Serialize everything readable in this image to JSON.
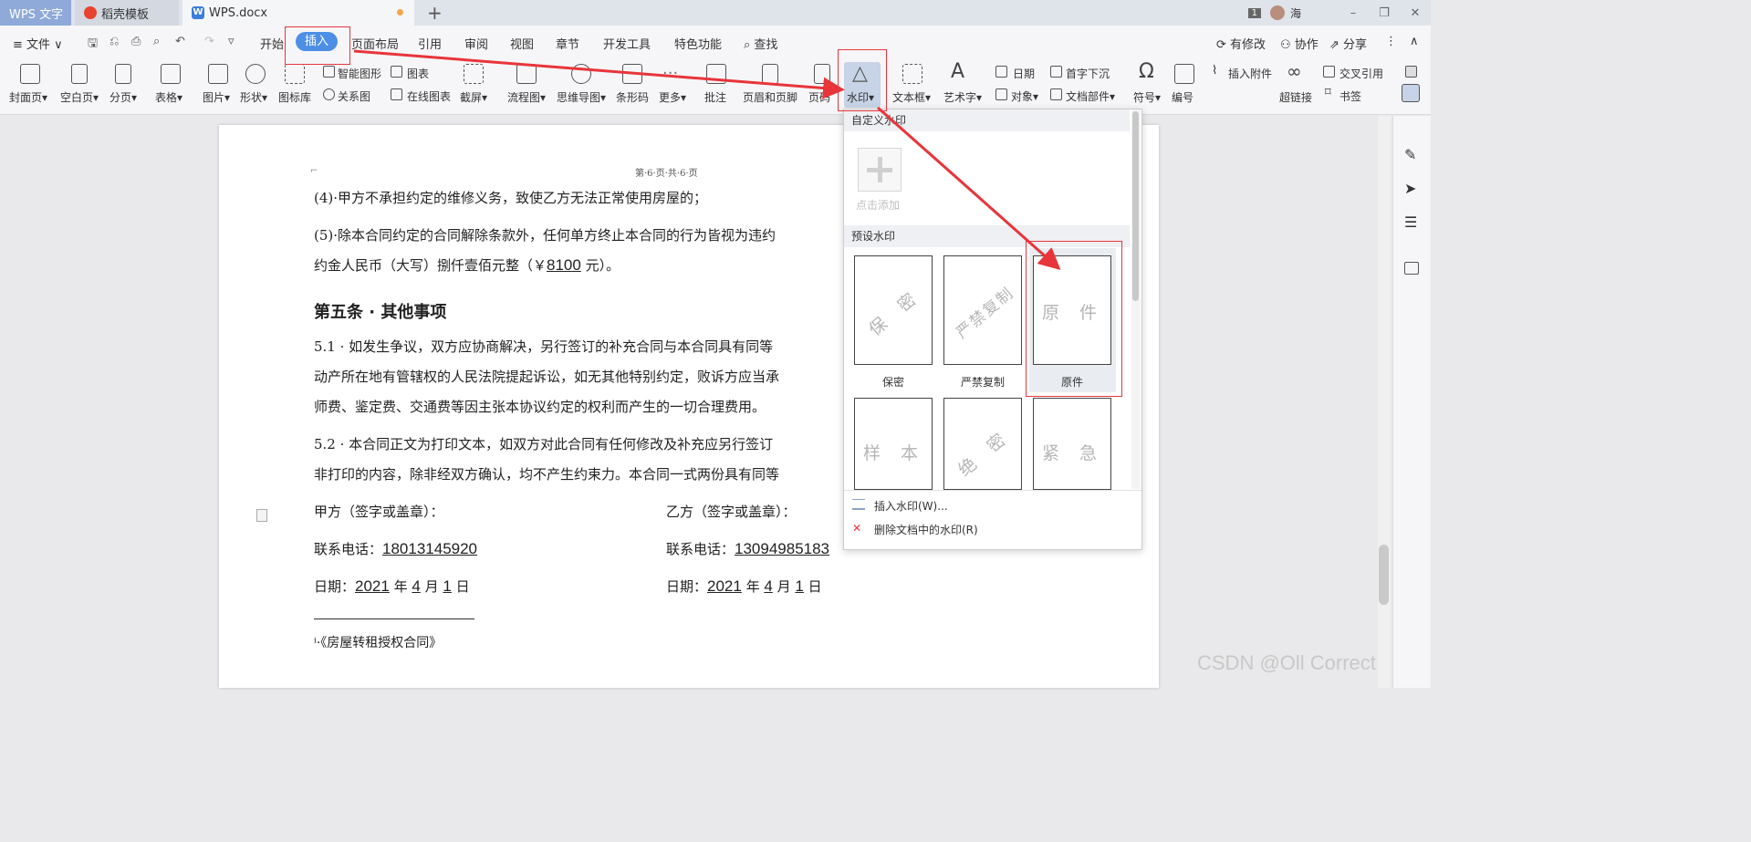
{
  "titlebar": {
    "app_tab": "WPS 文字",
    "docer_tab": "稻壳模板",
    "doc_tab": "WPS.docx",
    "add_tab": "+",
    "badge": "1",
    "user": "海",
    "min": "–",
    "max": "❐",
    "close": "✕"
  },
  "menubar": {
    "file": "≡ 文件 ∨",
    "tabs": [
      "开始",
      "插入",
      "页面布局",
      "引用",
      "审阅",
      "视图",
      "章节",
      "开发工具",
      "特色功能"
    ],
    "search": "查找",
    "right": [
      "有修改",
      "协作",
      "分享"
    ]
  },
  "ribbon": {
    "cover": "封面页",
    "blank": "空白页",
    "pagebreak": "分页",
    "table": "表格",
    "picture": "图片",
    "shape": "形状",
    "iconlib": "图标库",
    "smartart": "智能图形",
    "chart": "图表",
    "relation": "关系图",
    "online_chart": "在线图表",
    "screenshot": "截屏",
    "flowchart": "流程图",
    "mindmap": "思维导图",
    "barcode": "条形码",
    "more": "更多",
    "comment": "批注",
    "header_footer": "页眉和页脚",
    "page_no": "页码",
    "watermark": "水印",
    "textbox": "文本框",
    "wordart": "艺术字",
    "date": "日期",
    "object": "对象",
    "dropcap": "首字下沉",
    "docpart": "文档部件",
    "symbol": "符号",
    "number": "编号",
    "attach": "插入附件",
    "hyperlink": "超链接",
    "crossref": "交叉引用",
    "bookmark": "书签"
  },
  "document": {
    "page_header": "第·6·页·共·6·页",
    "item4": "(4)·甲方不承担约定的维修义务，致使乙方无法正常使用房屋的；",
    "item5_a": "(5)·除本合同约定的合同解除条款外，任何单方终止本合同的行为皆视为违约",
    "item5_b_pre": "约金人民币（大写）捌仟壹佰元整（￥",
    "item5_amount": "8100",
    "item5_b_post": " 元）。",
    "section5_title": "第五条 · 其他事项",
    "s51_a": "5.1 ·  如发生争议，双方应协商解决，另行签订的补充合同与本合同具有同等",
    "s51_b": "动产所在地有管辖权的人民法院提起诉讼，如无其他特别约定，败诉方应当承",
    "s51_c": "师费、鉴定费、交通费等因主张本协议约定的权利而产生的一切合理费用。",
    "s52_a": "5.2 ·  本合同正文为打印文本，如双方对此合同有任何修改及补充应另行签订",
    "s52_b": "非打印的内容，除非经双方确认，均不产生约束力。本合同一式两份具有同等",
    "party_a_sign": "甲方（签字或盖章）：",
    "party_b_sign": "乙方（签字或盖章）：",
    "phone_label": "联系电话：",
    "phone_a": "18013145920",
    "phone_b": "13094985183",
    "date_label": "日期：",
    "date_year": "2021",
    "date_y_unit": " 年 ",
    "date_month": "4",
    "date_m_unit": " 月 ",
    "date_day": "1",
    "date_d_unit": " 日",
    "footnote": "ⁱ·《房屋转租授权合同》"
  },
  "watermark_menu": {
    "custom_section": "自定义水印",
    "add_label": "点击添加",
    "preset_section": "预设水印",
    "presets": [
      {
        "text": "保 密",
        "label": "保密"
      },
      {
        "text": "严禁复制",
        "label": "严禁复制"
      },
      {
        "text": "原 件",
        "label": "原件"
      },
      {
        "text": "样 本",
        "label": ""
      },
      {
        "text": "绝 密",
        "label": ""
      },
      {
        "text": "紧 急",
        "label": ""
      }
    ],
    "insert_action": "插入水印(W)...",
    "delete_action": "删除文档中的水印(R)"
  },
  "watermark_credit": "CSDN @Oll Correct",
  "colors": {
    "accent": "#4e8fe6",
    "highlight": "#e8353a",
    "arrow": "#e8353a"
  }
}
